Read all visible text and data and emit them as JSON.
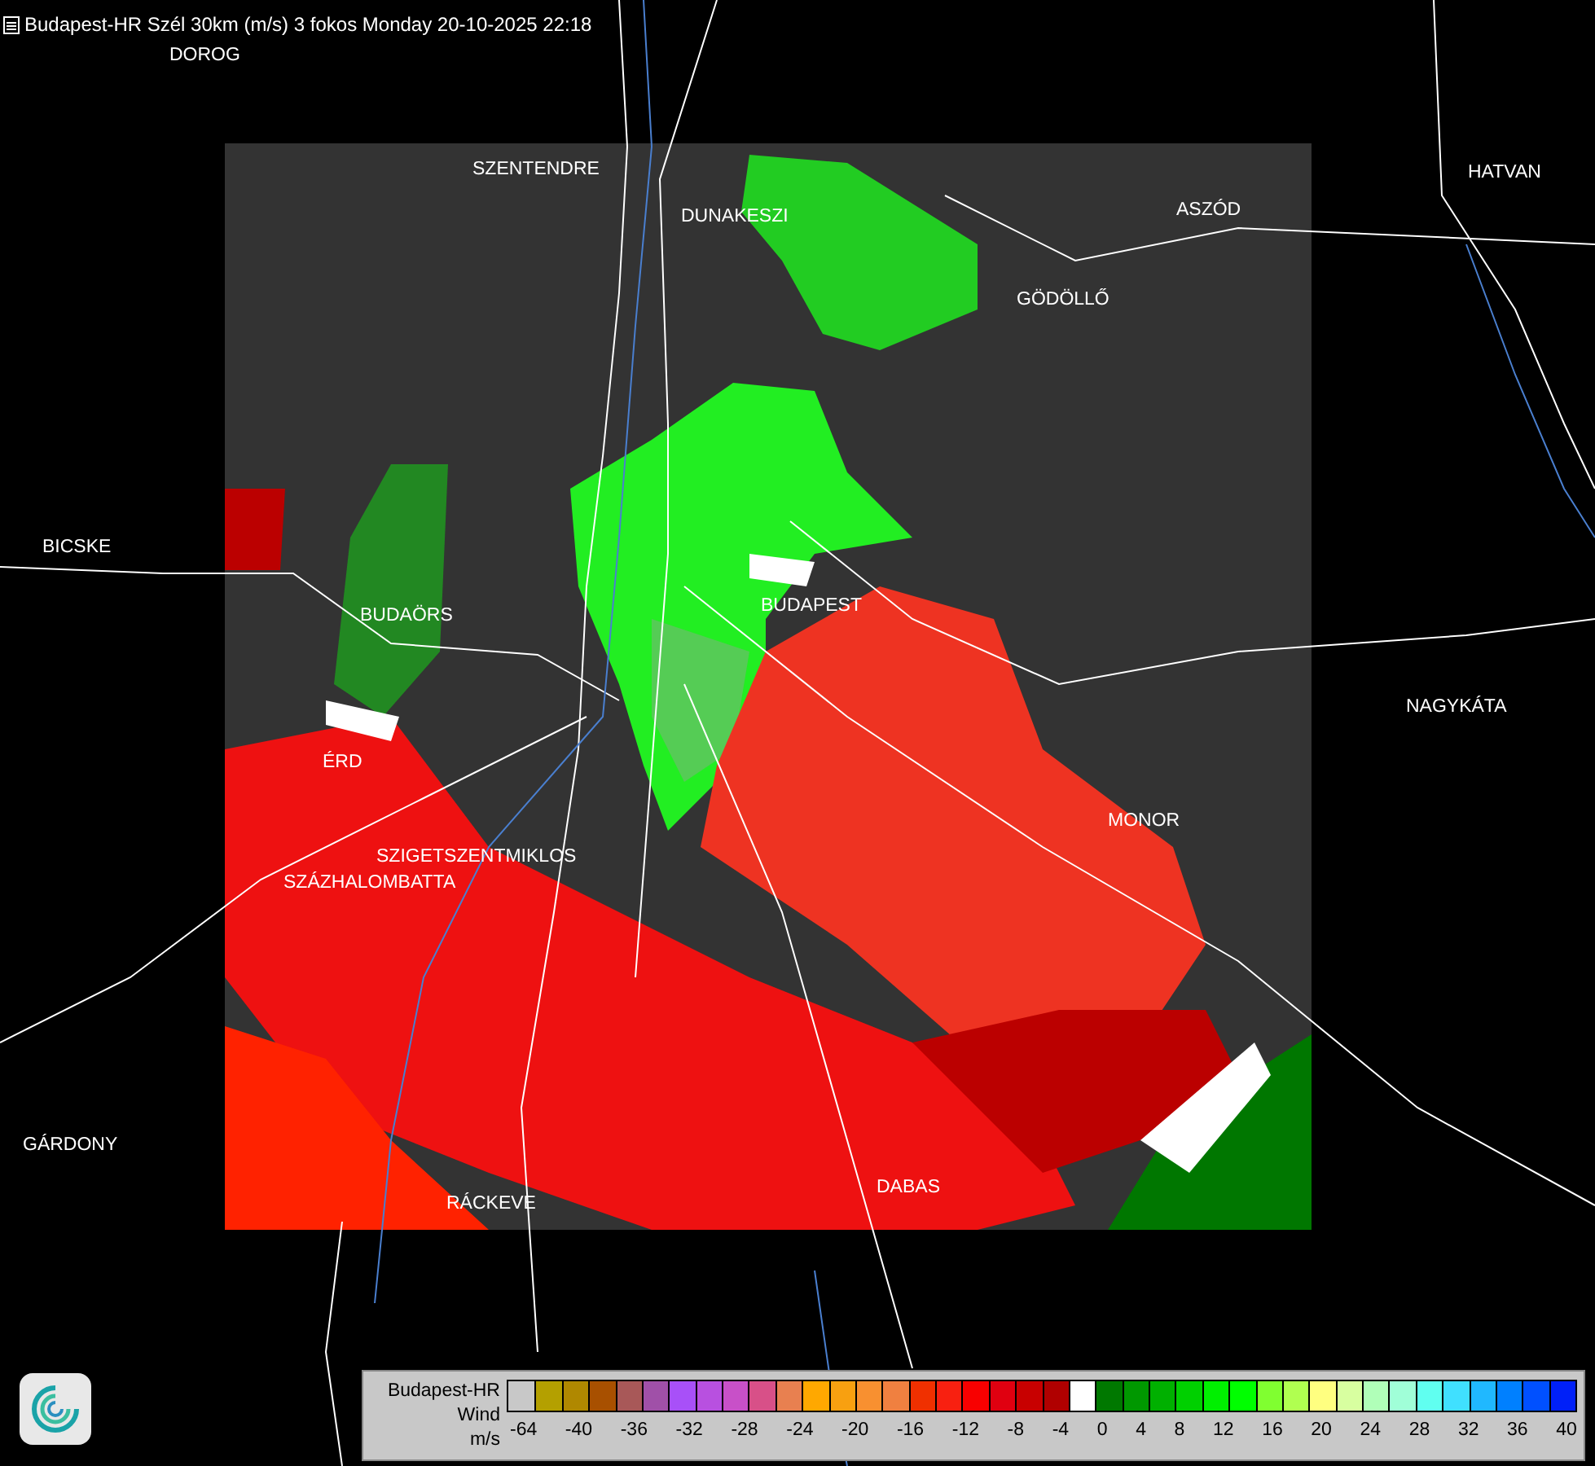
{
  "title": "Budapest-HR Szél 30km (m/s) 3 fokos Monday 20-10-2025 22:18",
  "places": [
    {
      "name": "DOROG"
    },
    {
      "name": "SZENTENDRE"
    },
    {
      "name": "DUNAKESZI"
    },
    {
      "name": "ASZÓD"
    },
    {
      "name": "HATVAN"
    },
    {
      "name": "GÖDÖLLŐ"
    },
    {
      "name": "BICSKE"
    },
    {
      "name": "BUDAÖRS"
    },
    {
      "name": "BUDAPEST"
    },
    {
      "name": "NAGYKÁTA"
    },
    {
      "name": "ÉRD"
    },
    {
      "name": "MONOR"
    },
    {
      "name": "SZIGETSZENTMIKLOS"
    },
    {
      "name": "SZÁZHALOMBATTA"
    },
    {
      "name": "GÁRDONY"
    },
    {
      "name": "RÁCKEVE"
    },
    {
      "name": "DABAS"
    }
  ],
  "legend": {
    "lines": [
      "Budapest-HR",
      "Wind",
      "m/s"
    ],
    "swatches": [
      {
        "color": "#c8c8c8"
      },
      {
        "color": "#b4a000"
      },
      {
        "color": "#b08800"
      },
      {
        "color": "#a85000"
      },
      {
        "color": "#a85858"
      },
      {
        "color": "#a050a8"
      },
      {
        "color": "#a850f8"
      },
      {
        "color": "#b850e0"
      },
      {
        "color": "#c850c8"
      },
      {
        "color": "#d85088"
      },
      {
        "color": "#e88050"
      },
      {
        "color": "#ffa800"
      },
      {
        "color": "#f8a010"
      },
      {
        "color": "#f89030"
      },
      {
        "color": "#f08040"
      },
      {
        "color": "#f03000"
      },
      {
        "color": "#f82010"
      },
      {
        "color": "#f80000"
      },
      {
        "color": "#e00010"
      },
      {
        "color": "#c80000"
      },
      {
        "color": "#b00000"
      },
      {
        "color": "#ffffff"
      },
      {
        "color": "#007800"
      },
      {
        "color": "#009800"
      },
      {
        "color": "#00b000"
      },
      {
        "color": "#00d000"
      },
      {
        "color": "#00f000"
      },
      {
        "color": "#00ff00"
      },
      {
        "color": "#80ff30"
      },
      {
        "color": "#b0ff50"
      },
      {
        "color": "#ffff80"
      },
      {
        "color": "#d8ffa0"
      },
      {
        "color": "#b0ffb8"
      },
      {
        "color": "#a0ffd8"
      },
      {
        "color": "#60fff0"
      },
      {
        "color": "#40e0ff"
      },
      {
        "color": "#20b8ff"
      },
      {
        "color": "#0080ff"
      },
      {
        "color": "#0050ff"
      },
      {
        "color": "#0020f8"
      }
    ],
    "ticks": [
      "-64",
      "-40",
      "-36",
      "-32",
      "-28",
      "-24",
      "-20",
      "-16",
      "-12",
      "-8",
      "-4",
      "0",
      "4",
      "8",
      "12",
      "16",
      "20",
      "24",
      "28",
      "32",
      "36",
      "40"
    ]
  }
}
